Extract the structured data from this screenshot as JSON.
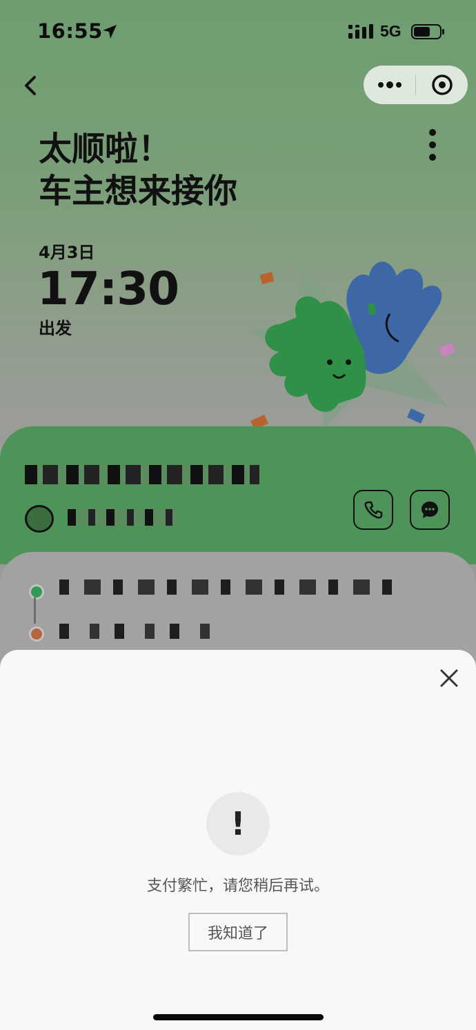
{
  "status_bar": {
    "time": "16:55",
    "network": "5G",
    "battery_level": 0.65
  },
  "header": {
    "back_icon": "chevron-left-icon",
    "capsule_more_icon": "more-dots-icon",
    "capsule_close_icon": "target-circle-icon"
  },
  "trip": {
    "headline_line1": "太顺啦！",
    "headline_line2": "车主想来接你",
    "date": "4月3日",
    "time": "17:30",
    "depart_label": "出发"
  },
  "driver_card": {
    "call_icon": "phone-icon",
    "chat_icon": "message-icon"
  },
  "dialog": {
    "close_icon": "close-icon",
    "alert_icon": "!",
    "message": "支付繁忙，请您稍后再试。",
    "confirm_label": "我知道了"
  },
  "colors": {
    "accent_green": "#4e9458",
    "start_dot": "#2f9b55",
    "end_dot": "#b5653f"
  }
}
